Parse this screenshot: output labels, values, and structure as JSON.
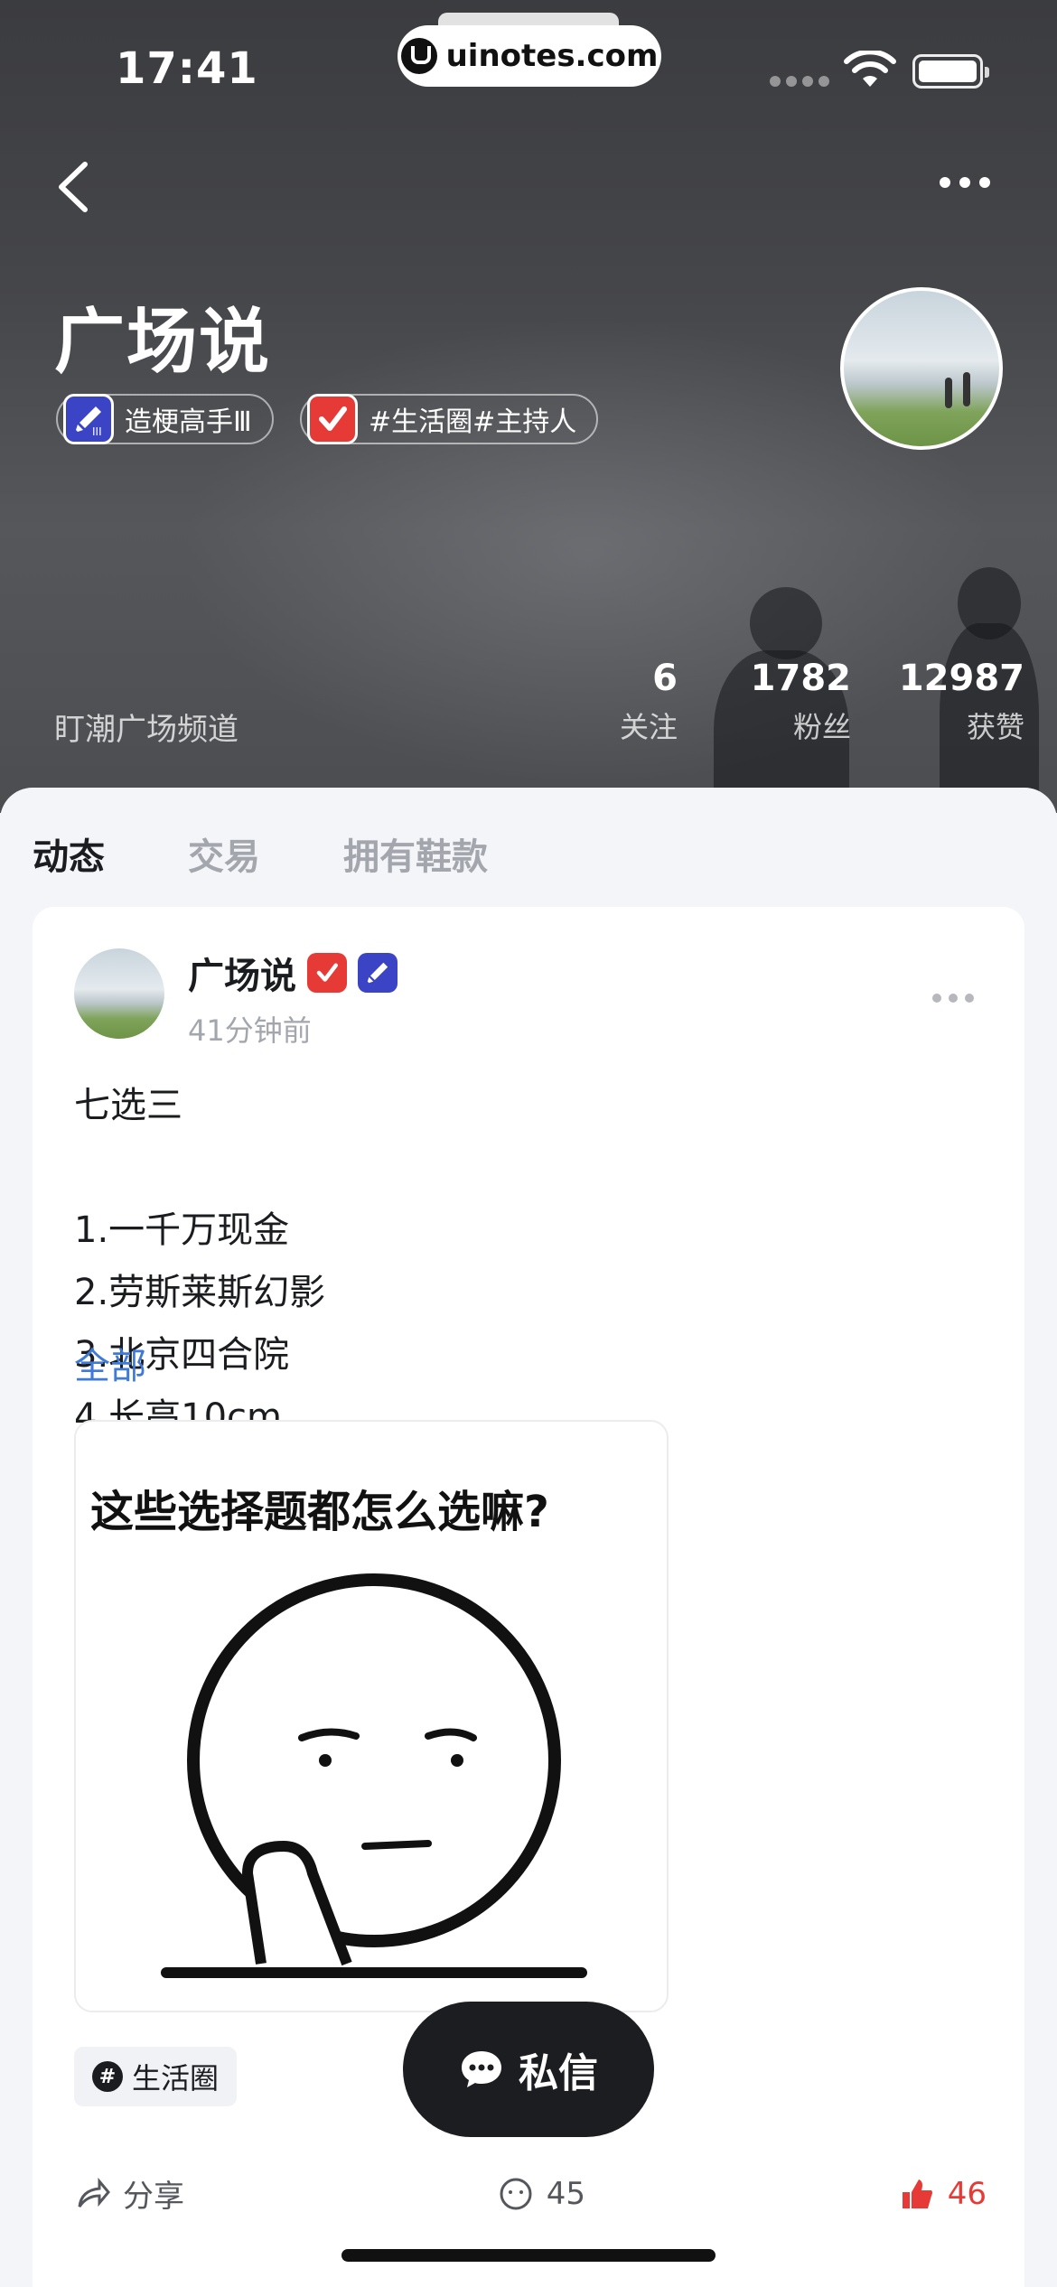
{
  "status_bar": {
    "time": "17:41",
    "url": "uinotes.com"
  },
  "profile": {
    "name": "广场说",
    "badges": [
      "造梗高手Ⅲ",
      "#生活圈#主持人"
    ],
    "channel": "盯潮广场频道",
    "stats": [
      {
        "value": "6",
        "label": "关注"
      },
      {
        "value": "1782",
        "label": "粉丝"
      },
      {
        "value": "12987",
        "label": "获赞"
      }
    ]
  },
  "tabs": [
    "动态",
    "交易",
    "拥有鞋款"
  ],
  "post": {
    "author": "广场说",
    "time": "41分钟前",
    "lines": [
      "七选三",
      "",
      "1.一千万现金",
      "2.劳斯莱斯幻影",
      "3.北京四合院",
      "4.长高10cm..."
    ],
    "more_label": "全部",
    "image_caption": "这些选择题都怎么选嘛?",
    "tag": "生活圈",
    "actions": {
      "share": "分享",
      "comments": "45",
      "likes": "46"
    }
  },
  "dm_button": {
    "label": "私信"
  },
  "colors": {
    "accent_red": "#e63a37",
    "badge_blue": "#3b44c4",
    "link_blue": "#3f7ad6",
    "dark": "#1c1d21"
  }
}
